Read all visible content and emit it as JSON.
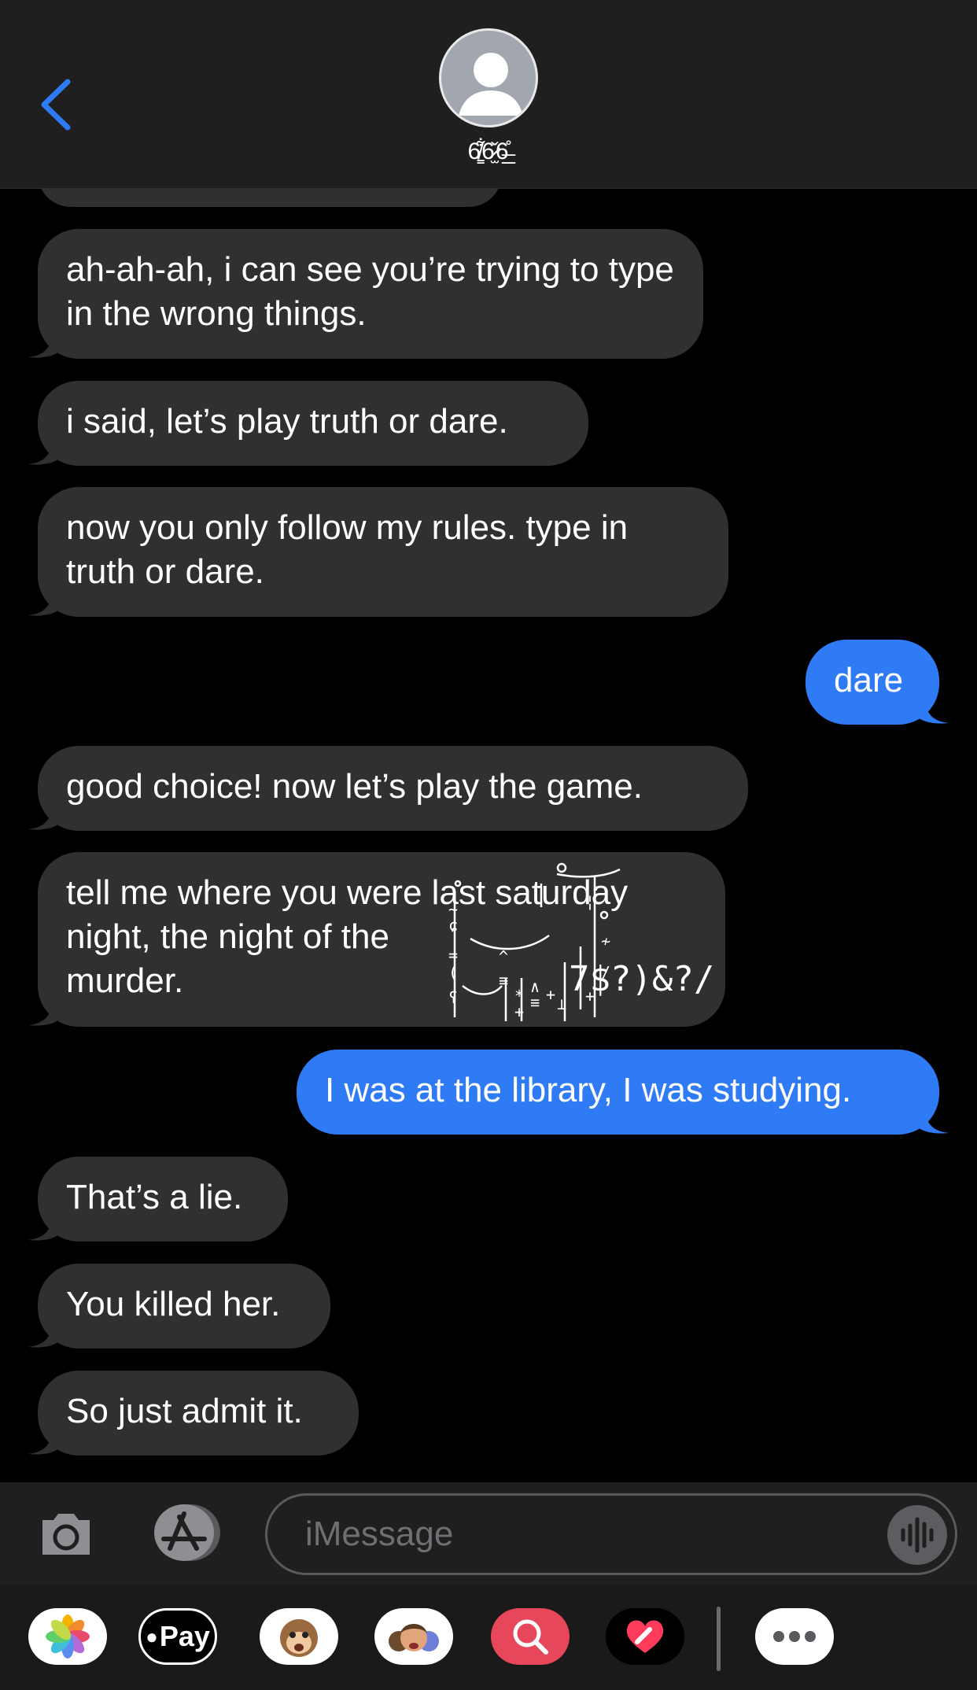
{
  "header": {
    "contact_name": "6̸̳͋6̷̫̌6̶̲̊",
    "back_icon": "chevron-left-icon",
    "avatar_icon": "person-silhouette-icon"
  },
  "messages": [
    {
      "side": "received",
      "text": "ah-ah-ah, i can see you’re trying to type in the wrong things."
    },
    {
      "side": "received",
      "text": "i said, let’s play truth or dare."
    },
    {
      "side": "received",
      "text": "now you only follow my rules. type in truth or dare."
    },
    {
      "side": "sent",
      "text": "dare"
    },
    {
      "side": "received",
      "text": "good choice! now let’s play the game."
    },
    {
      "side": "received",
      "line1": "tell me where you were last saturday",
      "line2": "night, the night of the",
      "line3": "murder.",
      "glitch": "7$?)&?/"
    },
    {
      "side": "sent",
      "text": "I was at the library, I was studying."
    },
    {
      "side": "received",
      "text": "That’s a lie."
    },
    {
      "side": "received",
      "text": "You killed her."
    },
    {
      "side": "received",
      "text": "So just admit it."
    }
  ],
  "input": {
    "placeholder": "iMessage",
    "camera_icon": "camera-icon",
    "apps_icon": "app-store-icon",
    "audio_icon": "waveform-icon"
  },
  "drawer": {
    "apple_pay_label": "Pay",
    "apps": [
      "photos-icon",
      "apple-pay-icon",
      "animoji-monkey-icon",
      "memoji-icon",
      "search-images-icon",
      "digital-touch-icon",
      "more-icon"
    ]
  },
  "colors": {
    "sent_bubble": "#2f7bf5",
    "received_bubble": "#303033",
    "accent": "#2f7bf5"
  }
}
